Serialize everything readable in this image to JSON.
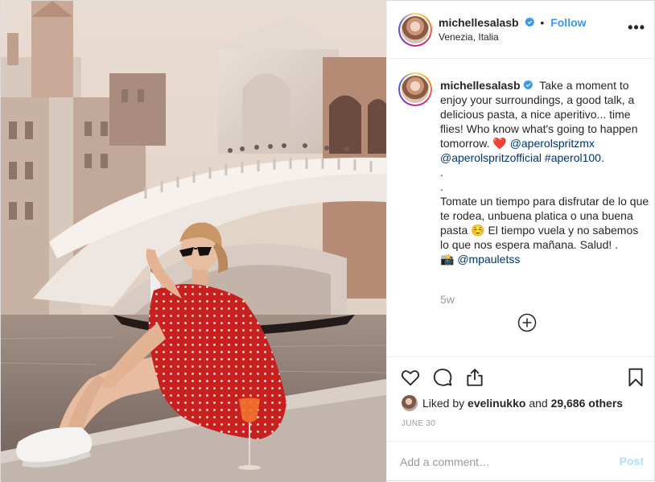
{
  "post": {
    "username": "michellesalasb",
    "follow_label": "Follow",
    "location": "Venezia, Italia",
    "more_label": "•••",
    "caption": {
      "lines_en": [
        "Take a moment to enjoy your surroundings, a good talk, a delicious pasta, a nice aperitivo... time flies! Who know what's going to happen tomorrow."
      ],
      "heart": "❤️",
      "mention_1": "@aperolspritzmx",
      "mention_2": "@aperolspritzofficial",
      "hashtag": "#aperol100.",
      "dot_1": ".",
      "dot_2": ".",
      "text_es": "Tomate un tiempo para disfrutar de lo que te rodea, unbuena platica o una buena pasta ☺️ El tiempo vuela y no sabemos lo que nos espera mañana. Salud! .",
      "camera": "📸",
      "photo_credit": "@mpauletss"
    },
    "age": "5w",
    "likes": {
      "prefix": "Liked by",
      "user": "evelinukko",
      "and": "and",
      "count": "29,686 others"
    },
    "date": "JUNE 30",
    "comment_placeholder": "Add a comment…",
    "post_label": "Post"
  },
  "colors": {
    "link": "#003569",
    "follow": "#3897f0",
    "heart": "#ed4956",
    "post_disabled": "#b2dffc",
    "dress_red": "#c8201e"
  },
  "icons": [
    "verified-badge-icon",
    "more-options-icon",
    "load-more-icon",
    "heart-icon",
    "comment-icon",
    "share-icon",
    "bookmark-icon"
  ]
}
